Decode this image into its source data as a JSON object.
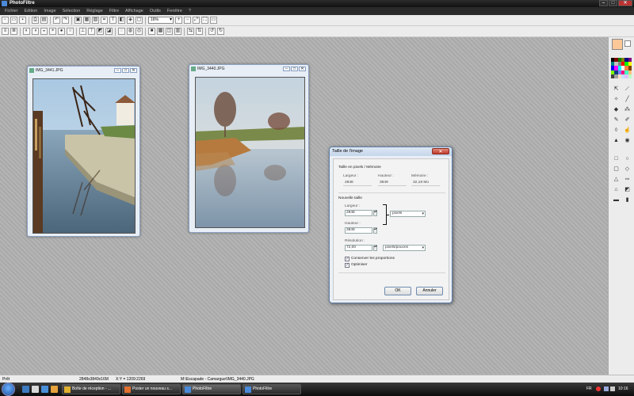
{
  "app": {
    "title": "PhotoFiltre"
  },
  "menu": [
    "Fichier",
    "Edition",
    "Image",
    "Sélection",
    "Réglage",
    "Filtre",
    "Affichage",
    "Outils",
    "Fenêtre",
    "?"
  ],
  "toolbar": {
    "zoom": "16%",
    "text_tool": "T"
  },
  "windows": [
    {
      "title": "IMG_3441.JPG"
    },
    {
      "title": "IMG_3440.JPG"
    }
  ],
  "dialog": {
    "title": "Taille de l'image",
    "current_section": "Taille en pixels / Mémoire",
    "current_labels": {
      "width": "Largeur :",
      "height": "Hauteur :",
      "memory": "Mémoire :"
    },
    "current_values": {
      "width": "2848",
      "height": "3849",
      "memory": "32,18 Mo"
    },
    "new_section": "Nouvelle taille",
    "width_label": "Largeur :",
    "width_value": "2848",
    "height_label": "Hauteur :",
    "height_value": "3849",
    "unit": "pixels",
    "resolution_label": "Résolution :",
    "resolution_value": "72,00",
    "resolution_unit": "pixels/pouces",
    "keep_ratio_label": "Conserver les proportions",
    "keep_ratio_checked": true,
    "optimize_label": "Optimiser",
    "optimize_checked": true,
    "ok_label": "OK",
    "cancel_label": "Annuler"
  },
  "status": {
    "state": "Prêt",
    "dimensions": "2848x3849x16M",
    "coords": "X:Y = 1209:2269",
    "path": "M:\\Escapade - Camargue\\IMG_3440.JPG"
  },
  "taskbar": {
    "items": [
      {
        "label": "Boîte de réception - ..."
      },
      {
        "label": "Poster un nouveau s..."
      },
      {
        "label": "PhotoFiltre"
      },
      {
        "label": "PhotoFiltre"
      }
    ],
    "lang": "FR",
    "clock": "10:16"
  },
  "colors": {
    "foreground": "#fcc898",
    "background": "#ffffff",
    "accent": "#5e7ea6"
  }
}
